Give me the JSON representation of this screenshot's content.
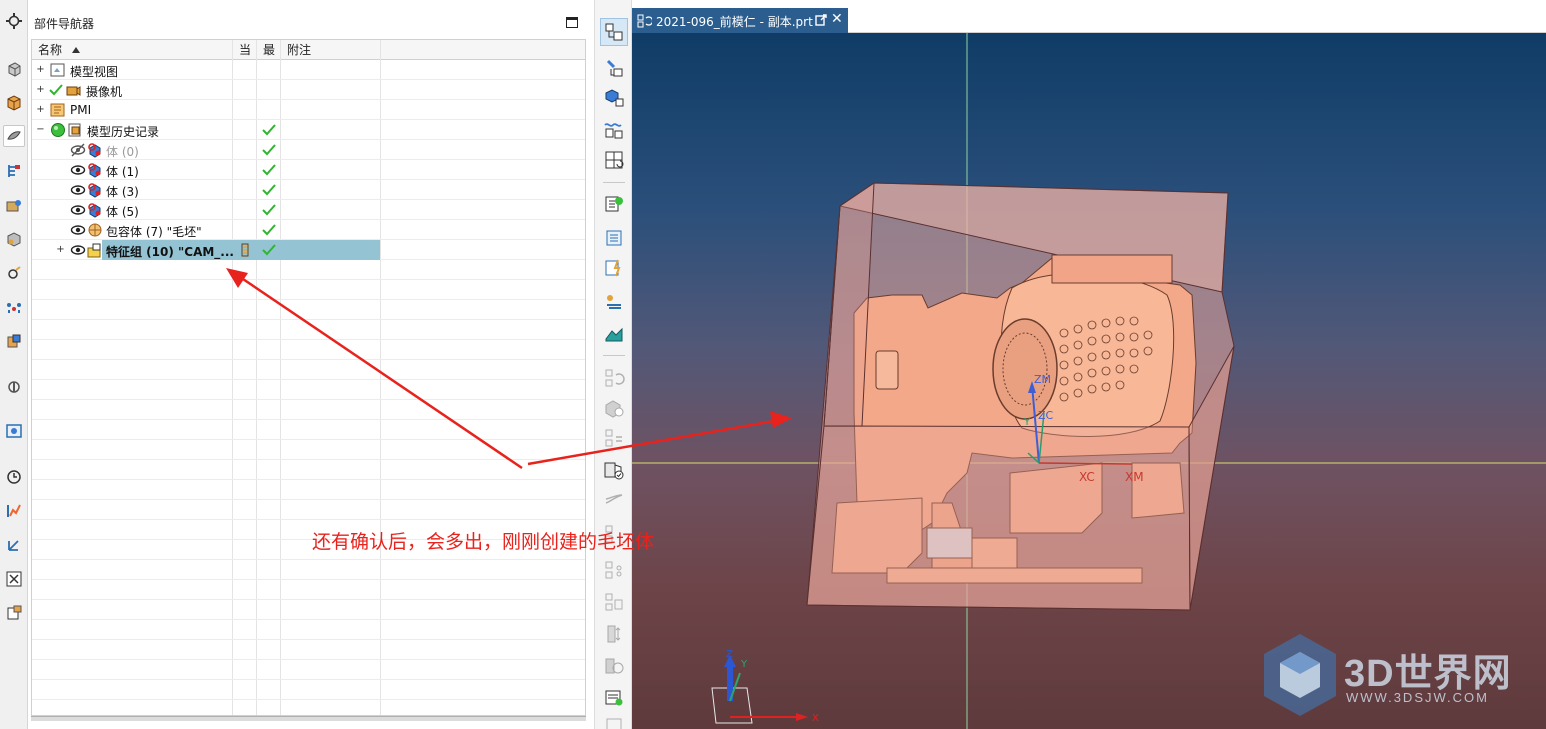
{
  "navigator": {
    "title": "部件导航器",
    "columns": {
      "name": "名称",
      "current": "当",
      "latest": "最",
      "comment": "附注"
    },
    "rows": [
      {
        "label": "模型视图",
        "icon": "model-views-icon",
        "expand": "+",
        "check": false
      },
      {
        "label": "摄像机",
        "icon": "camera-icon",
        "expand": "+",
        "check": false
      },
      {
        "label": "PMI",
        "icon": "pmi-icon",
        "expand": "+",
        "check": false
      },
      {
        "label": "模型历史记录",
        "icon": "model-history-icon",
        "expand": "−",
        "check": true
      },
      {
        "label": "体 (0)",
        "icon": "body-icon",
        "check": true
      },
      {
        "label": "体 (1)",
        "icon": "body-icon",
        "check": true
      },
      {
        "label": "体 (3)",
        "icon": "body-icon",
        "check": true
      },
      {
        "label": "体 (5)",
        "icon": "body-icon",
        "check": true
      },
      {
        "label": "包容体 (7) \"毛坯\"",
        "icon": "bounding-body-icon",
        "check": true
      },
      {
        "label": "特征组 (10) \"CAM_...",
        "icon": "feature-group-icon",
        "expand": "+",
        "check": true
      }
    ]
  },
  "graphics": {
    "tab_title": "2021-096_前模仁 - 副本.prt",
    "close_glyph": "✕",
    "axis_labels": {
      "zm": "ZM",
      "zc": "ZC",
      "yc": "Y",
      "xc": "XC",
      "xm": "XM",
      "triad_z": "Z",
      "triad_y": "Y",
      "triad_x": "X"
    }
  },
  "annotation": {
    "text": "还有确认后，会多出，刚刚创建的毛坯体",
    "color": "#e8231d"
  },
  "watermark": {
    "main": "3D世界网",
    "sub": "WWW.3DSJW.COM"
  },
  "colors": {
    "tab_bg": "#2b5e8f",
    "selection": "#94c4d4",
    "check": "#2fb52f"
  }
}
